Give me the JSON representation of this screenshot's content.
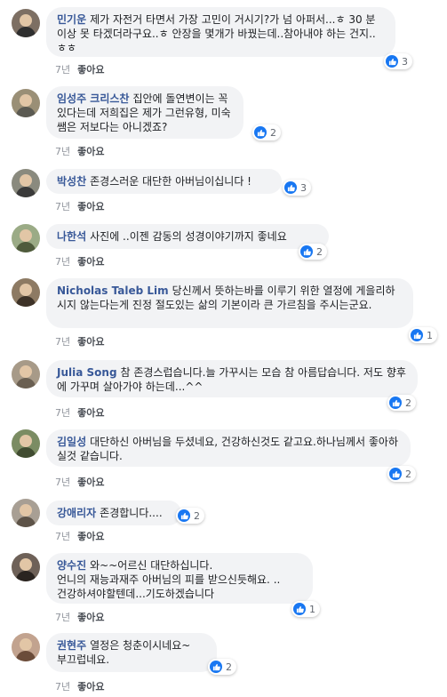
{
  "comments": [
    {
      "author": "민기운",
      "text": "제가 자전거 타면서 가장 고민이 거시기?가 넘 아퍼서...ㅎ 30 분이상 못 타겠더라구요..ㅎ 안장을 몇개가 바꿨는데..참아내야 하는 건지..ㅎㅎ",
      "time": "7년",
      "like_label": "좋아요",
      "likes": "3"
    },
    {
      "author": "임성주 크리스찬",
      "text": "집안에 돌연변이는 꼭 있다는데 저희집은 제가 그런유형, 미숙쌤은 저보다는 아니겠죠?",
      "time": "7년",
      "like_label": "좋아요",
      "likes": "2"
    },
    {
      "author": "박성찬",
      "text": "존경스러운 대단한 아버님이십니다 !",
      "time": "7년",
      "like_label": "좋아요",
      "likes": "3"
    },
    {
      "author": "나한석",
      "text": "사진에 ..이젠 감동의 성경이야기까지 좋네요",
      "time": "7년",
      "like_label": "좋아요",
      "likes": "2"
    },
    {
      "author": "Nicholas Taleb Lim",
      "text": "당신께서 뜻하는바를 이루기 위한 열정에 게을리하시지 않는다는게 진정 절도있는 삶의 기본이라 큰 가르침을 주시는군요.",
      "time": "7년",
      "like_label": "좋아요",
      "likes": "1"
    },
    {
      "author": "Julia Song",
      "text": "참 존경스럽습니다.늘 가꾸시는 모습 참 아름답습니다. 저도 향후에 가꾸며 살아가야 하는데...^^",
      "time": "7년",
      "like_label": "좋아요",
      "likes": "2"
    },
    {
      "author": "김일성",
      "text": "대단하신 아버님을 두셨네요, 건강하신것도 같고요.하나님께서 좋아하실것 같습니다.",
      "time": "7년",
      "like_label": "좋아요",
      "likes": "2"
    },
    {
      "author": "강애리자",
      "text": "존경합니다....",
      "time": "7년",
      "like_label": "좋아요",
      "likes": "2"
    },
    {
      "author": "양수진",
      "text": "와~~어르신 대단하십니다.\n언니의 재능과재주 아버님의 피를 받으신듯해요. ..\n건강하셔야할텐데...기도하겠습니다",
      "time": "7년",
      "like_label": "좋아요",
      "likes": "1"
    },
    {
      "author": "권현주",
      "text": "열정은 청춘이시네요~\n부끄럽네요.",
      "time": "7년",
      "like_label": "좋아요",
      "likes": "2"
    }
  ],
  "colors": {
    "author": "#385898",
    "bubble": "#f2f3f5",
    "like": "#1877f2"
  },
  "icons": {
    "like": "thumbs-up-icon",
    "avatar": "profile-photo"
  }
}
